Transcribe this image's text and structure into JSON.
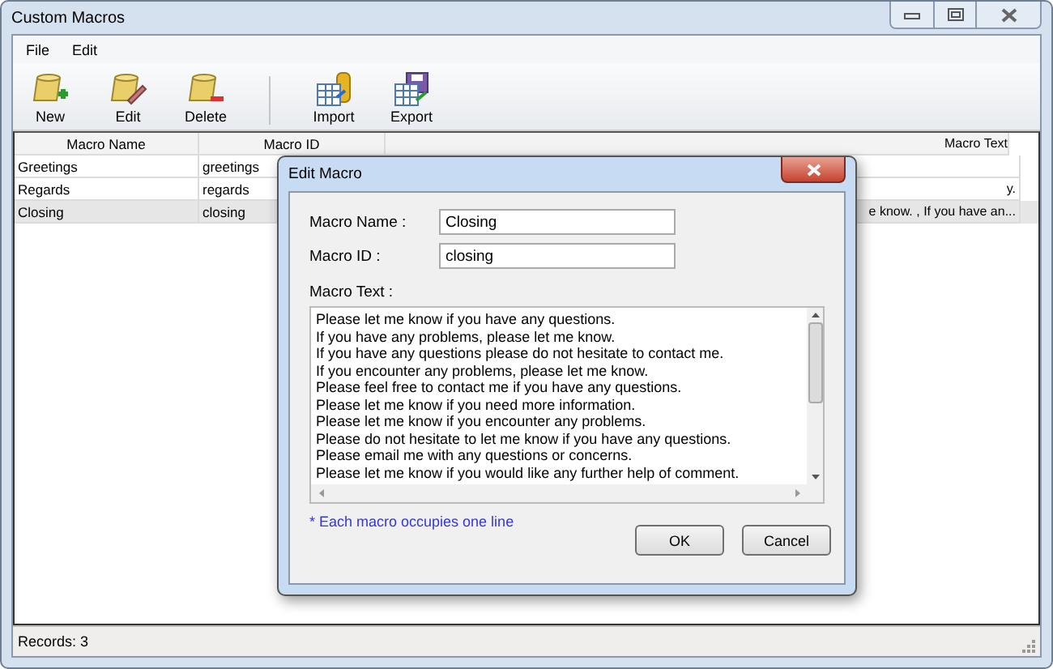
{
  "window": {
    "title": "Custom Macros"
  },
  "menu": [
    "File",
    "Edit"
  ],
  "toolbar": [
    {
      "label": "New",
      "kind": "new"
    },
    {
      "label": "Edit",
      "kind": "edit"
    },
    {
      "label": "Delete",
      "kind": "delete"
    },
    {
      "label": "Import",
      "kind": "import"
    },
    {
      "label": "Export",
      "kind": "export"
    }
  ],
  "table": {
    "columns": [
      "Macro Name",
      "Macro ID",
      "Macro Text"
    ],
    "rows": [
      {
        "cells": [
          "Greetings",
          "greetings",
          ""
        ],
        "selected": false
      },
      {
        "cells": [
          "Regards",
          "regards",
          "y."
        ],
        "selected": false
      },
      {
        "cells": [
          "Closing",
          "closing",
          "e know. , If you have an..."
        ],
        "selected": true
      }
    ]
  },
  "status_bar": "Records: 3",
  "dialog": {
    "title": "Edit Macro",
    "name_label": "Macro Name :",
    "name_value": "Closing",
    "id_label": "Macro ID :",
    "id_value": "closing",
    "text_label": "Macro Text :",
    "text_lines": [
      "Please let me know if you have any questions.",
      "If you have any problems, please let me know.",
      "If you have any questions please do not hesitate to contact me.",
      "If you encounter any problems, please let me know.",
      "Please feel free to contact me if you have any questions.",
      "Please let me know if you need more information.",
      "Please let me know if you encounter any problems.",
      "Please do not hesitate to let me know if you have any questions.",
      "Please email me with any questions or concerns.",
      "Please let me know if you would like any further help of comment."
    ],
    "note": "* Each macro occupies one line",
    "buttons": [
      "OK",
      "Cancel"
    ]
  }
}
